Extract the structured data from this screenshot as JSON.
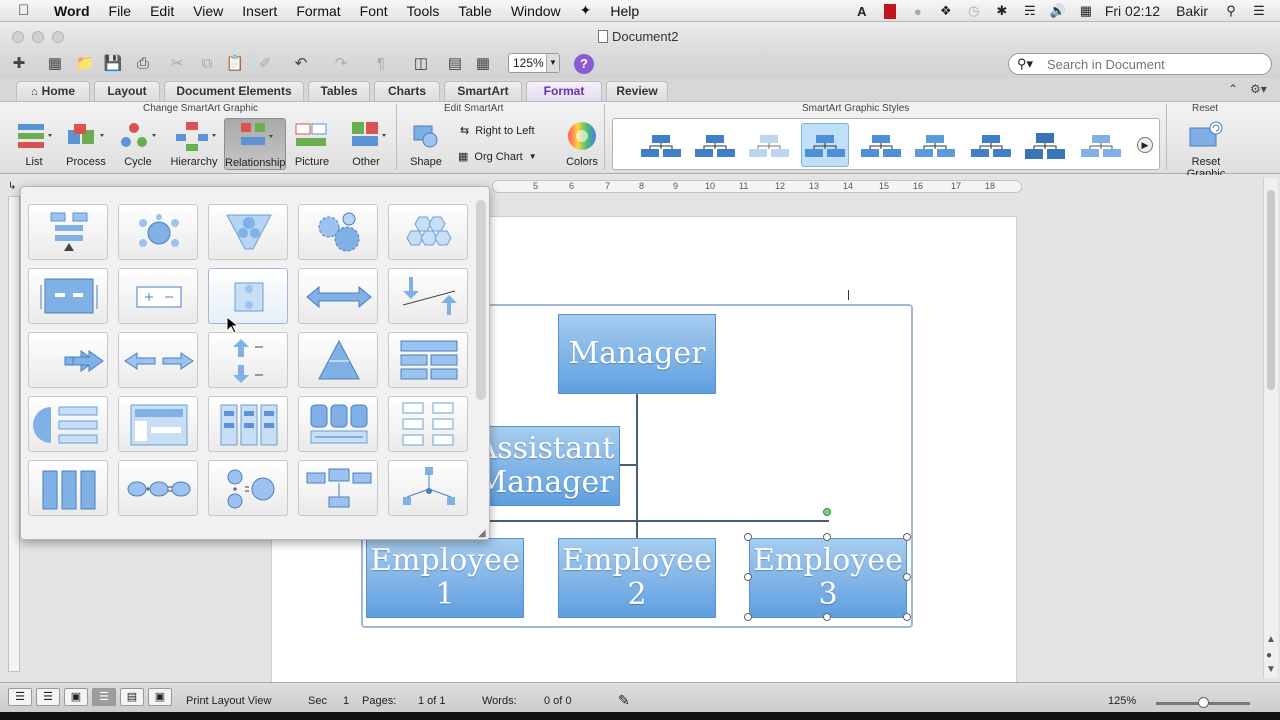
{
  "menubar": {
    "app": "Word",
    "items": [
      "File",
      "Edit",
      "View",
      "Insert",
      "Format",
      "Font",
      "Tools",
      "Table",
      "Window",
      "Help"
    ],
    "clock": "Fri 02:12",
    "user": "Bakir"
  },
  "window": {
    "title": "Document2"
  },
  "toolbar": {
    "zoom": "125%",
    "search_placeholder": "Search in Document"
  },
  "tabs": [
    "Home",
    "Layout",
    "Document Elements",
    "Tables",
    "Charts",
    "SmartArt",
    "Format",
    "Review"
  ],
  "ribbon": {
    "groups": {
      "change": "Change SmartArt Graphic",
      "edit": "Edit SmartArt",
      "styles": "SmartArt Graphic Styles",
      "reset": "Reset"
    },
    "buttons": [
      "List",
      "Process",
      "Cycle",
      "Hierarchy",
      "Relationship",
      "Picture",
      "Other"
    ],
    "shape": "Shape",
    "right_to_left": "Right to Left",
    "org_chart": "Org Chart",
    "colors": "Colors",
    "reset_graphic": "Reset Graphic"
  },
  "ruler": {
    "h_ticks": [
      "5",
      "6",
      "7",
      "8",
      "9",
      "10",
      "11",
      "12",
      "13",
      "14",
      "15",
      "16",
      "17",
      "18"
    ]
  },
  "smartart": {
    "manager": "Manager",
    "assistant_line1": "Assistant",
    "assistant_line2": "Manager",
    "employees": [
      {
        "line1": "Employee",
        "line2": "1"
      },
      {
        "line1": "Employee",
        "line2": "2"
      },
      {
        "line1": "Employee",
        "line2": "3"
      }
    ]
  },
  "statusbar": {
    "view": "Print Layout View",
    "sec_label": "Sec",
    "sec": "1",
    "pages_label": "Pages:",
    "pages": "1 of 1",
    "words_label": "Words:",
    "words": "0 of 0",
    "zoom": "125%"
  },
  "colors": {
    "accent": "#6a2fa8",
    "box": "#5f9fe0",
    "help": "#8a5bd6"
  }
}
